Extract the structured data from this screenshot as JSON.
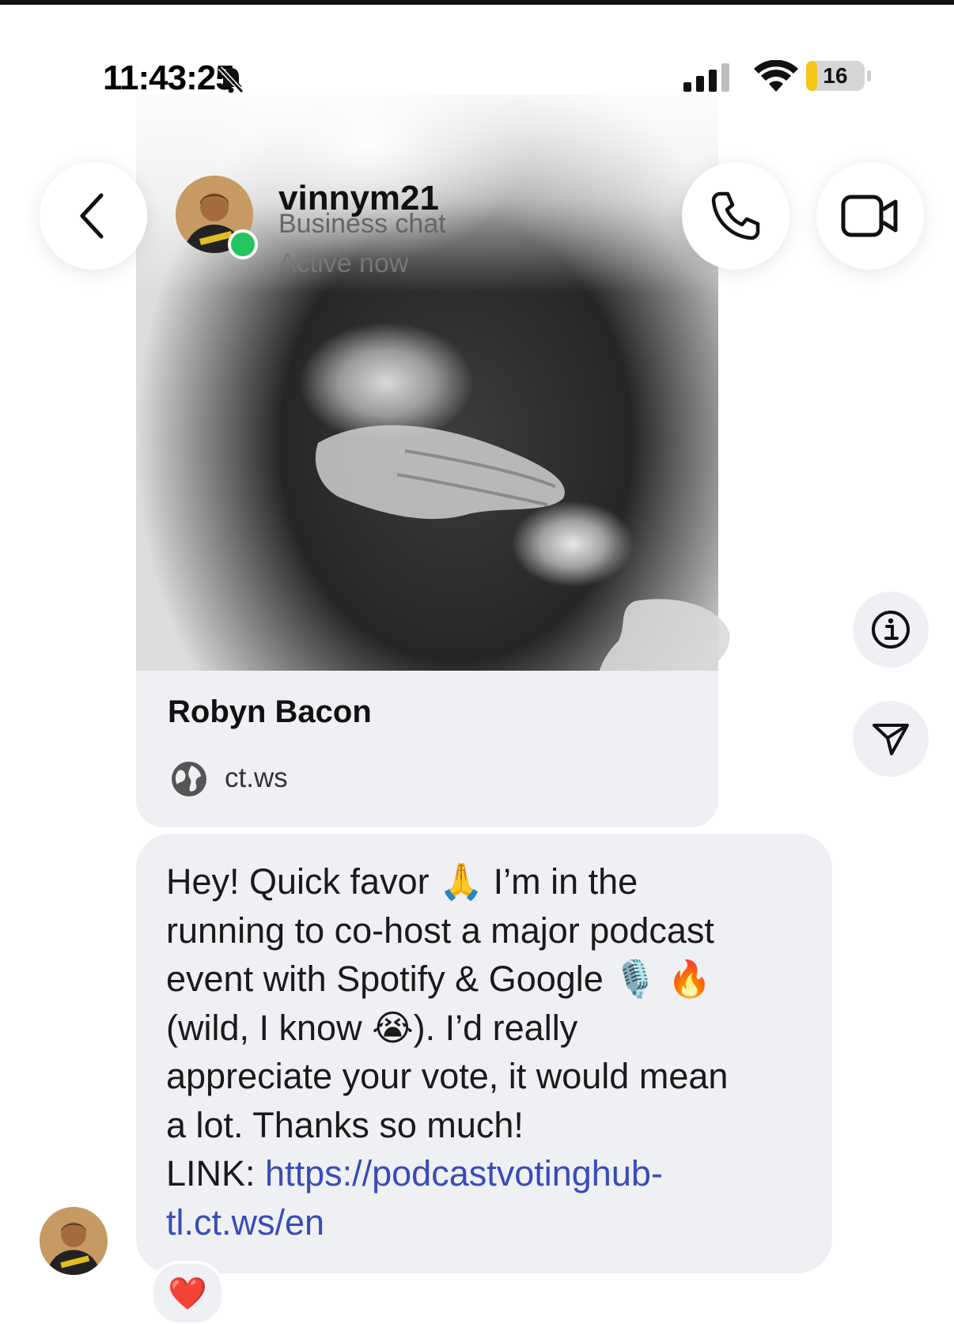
{
  "status_bar": {
    "time": "11:43:25",
    "battery": "16"
  },
  "header": {
    "username": "vinnym21",
    "subtitle": "Business chat",
    "status": "Active now"
  },
  "link_preview": {
    "title": "Robyn Bacon",
    "domain": "ct.ws"
  },
  "message": {
    "lines": [
      "Hey! Quick favor 🙏 I’m in the",
      "running to co-host a major podcast",
      "event with Spotify & Google 🎙️ 🔥",
      "(wild, I know 😭). I’d really",
      "appreciate your vote, it would mean",
      "a lot. Thanks so much!"
    ],
    "link_label": "LINK: ",
    "link_line1": "https://podcastvotinghub-",
    "link_line2": "tl.ct.ws/en"
  },
  "reaction": "❤️",
  "icons": {
    "back": "chevron-left-icon",
    "call": "phone-icon",
    "video": "video-camera-icon",
    "info": "info-icon",
    "send": "send-icon",
    "globe": "globe-icon",
    "notifications": "bell-off-icon"
  },
  "colors": {
    "bubble": "#eef0f3",
    "link": "#3a4bb8",
    "online": "#22c55e",
    "battery": "#f5c518"
  }
}
